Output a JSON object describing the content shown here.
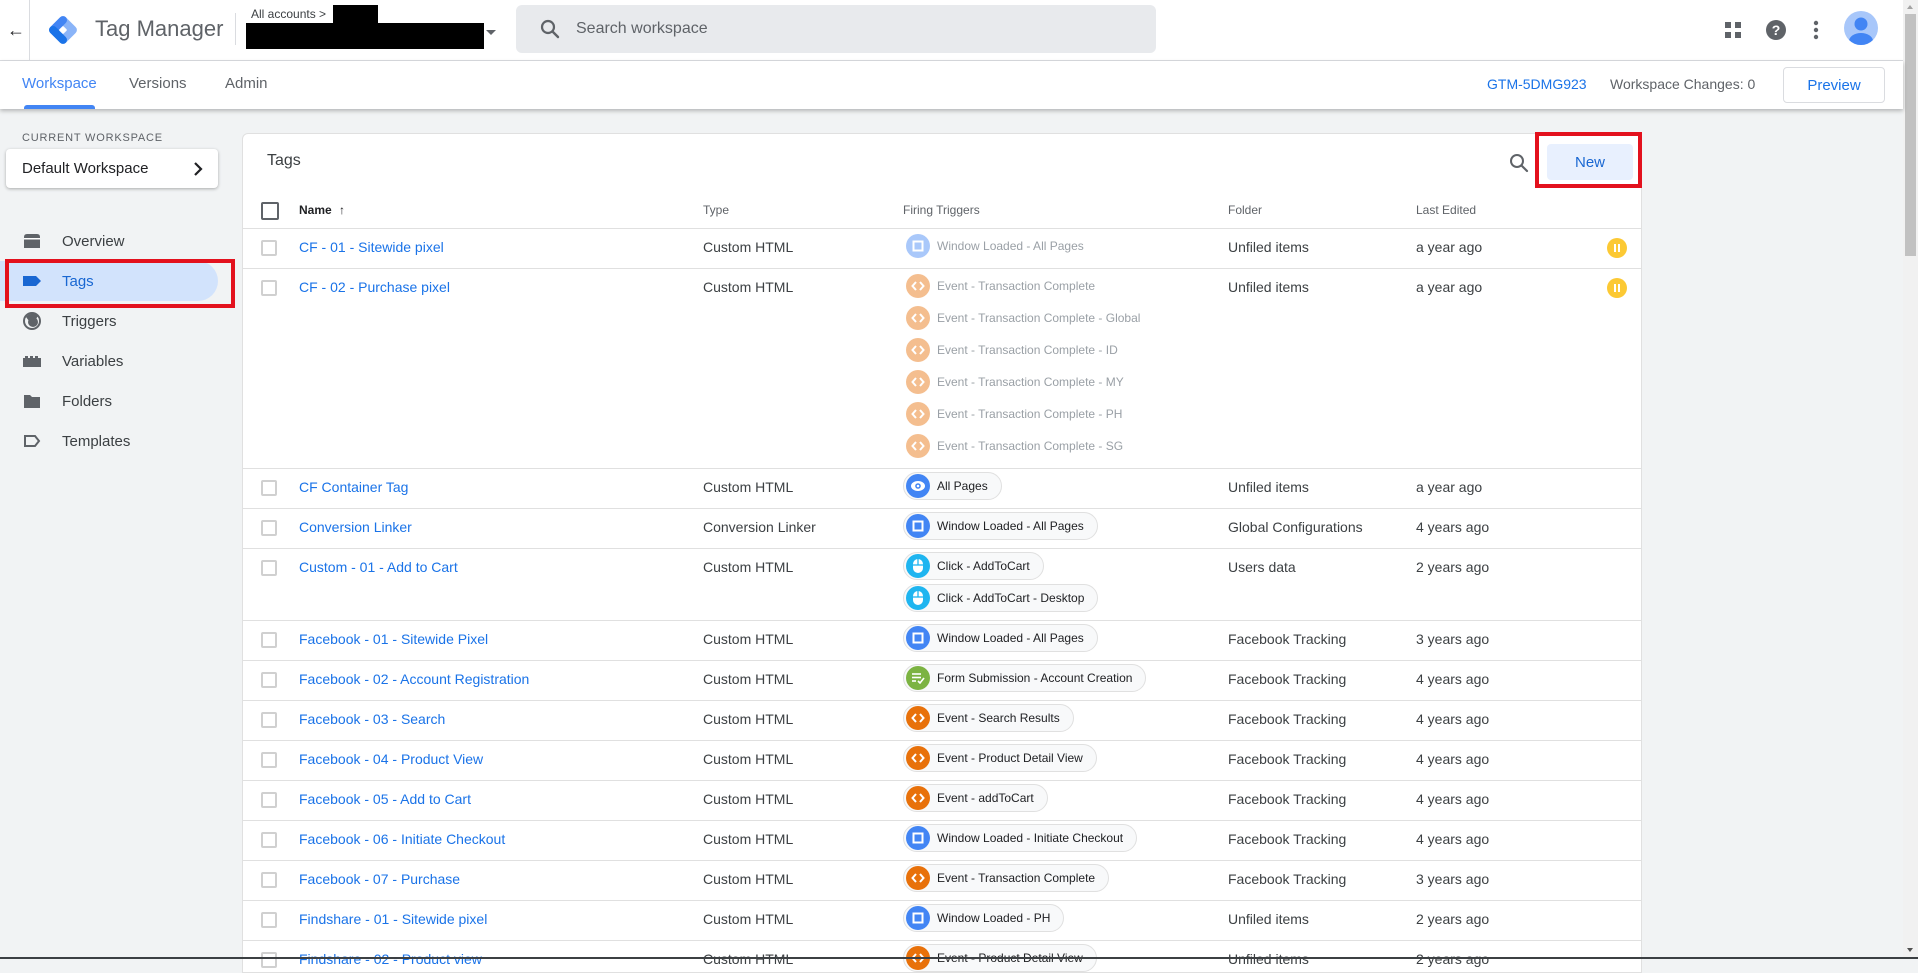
{
  "header": {
    "back_icon": "arrow-left-icon",
    "app_title": "Tag Manager",
    "account_crumb": "All accounts >",
    "search_placeholder": "Search workspace",
    "icons": [
      "apps-grid-icon",
      "help-icon",
      "more-vert-icon",
      "account-avatar-icon"
    ]
  },
  "tabs": [
    {
      "label": "Workspace",
      "active": true
    },
    {
      "label": "Versions",
      "active": false
    },
    {
      "label": "Admin",
      "active": false
    }
  ],
  "container": {
    "id": "GTM-5DMG923",
    "workspace_changes": "Workspace Changes: 0",
    "preview_label": "Preview"
  },
  "sidebar": {
    "current_workspace_label": "CURRENT WORKSPACE",
    "workspace_name": "Default Workspace",
    "items": [
      {
        "label": "Overview",
        "icon": "overview-icon",
        "active": false
      },
      {
        "label": "Tags",
        "icon": "tag-icon",
        "active": true
      },
      {
        "label": "Triggers",
        "icon": "trigger-icon",
        "active": false
      },
      {
        "label": "Variables",
        "icon": "variables-icon",
        "active": false
      },
      {
        "label": "Folders",
        "icon": "folder-icon",
        "active": false
      },
      {
        "label": "Templates",
        "icon": "template-icon",
        "active": false
      }
    ]
  },
  "tags_card": {
    "title": "Tags",
    "new_label": "New",
    "columns": {
      "name": "Name",
      "type": "Type",
      "triggers": "Firing Triggers",
      "folder": "Folder",
      "edited": "Last Edited"
    },
    "sort": "Name ascending",
    "rows": [
      {
        "name": "CF - 01 - Sitewide pixel",
        "type": "Custom HTML",
        "folder": "Unfiled items",
        "edited": "a year ago",
        "paused": true,
        "triggers": [
          {
            "label": "Window Loaded - All Pages",
            "kind": "window",
            "color": "#4285f4"
          }
        ]
      },
      {
        "name": "CF - 02 - Purchase pixel",
        "type": "Custom HTML",
        "folder": "Unfiled items",
        "edited": "a year ago",
        "paused": true,
        "triggers": [
          {
            "label": "Event - Transaction Complete",
            "kind": "event",
            "color": "#e8710a"
          },
          {
            "label": "Event - Transaction Complete - Global",
            "kind": "event",
            "color": "#e8710a"
          },
          {
            "label": "Event - Transaction Complete - ID",
            "kind": "event",
            "color": "#e8710a"
          },
          {
            "label": "Event - Transaction Complete - MY",
            "kind": "event",
            "color": "#e8710a"
          },
          {
            "label": "Event - Transaction Complete - PH",
            "kind": "event",
            "color": "#e8710a"
          },
          {
            "label": "Event - Transaction Complete - SG",
            "kind": "event",
            "color": "#e8710a"
          }
        ]
      },
      {
        "name": "CF Container Tag",
        "type": "Custom HTML",
        "folder": "Unfiled items",
        "edited": "a year ago",
        "paused": false,
        "triggers": [
          {
            "label": "All Pages",
            "kind": "pageview",
            "color": "#4285f4"
          }
        ]
      },
      {
        "name": "Conversion Linker",
        "type": "Conversion Linker",
        "folder": "Global Configurations",
        "edited": "4 years ago",
        "paused": false,
        "triggers": [
          {
            "label": "Window Loaded - All Pages",
            "kind": "window",
            "color": "#4285f4"
          }
        ]
      },
      {
        "name": "Custom - 01 - Add to Cart",
        "type": "Custom HTML",
        "folder": "Users data",
        "edited": "2 years ago",
        "paused": false,
        "triggers": [
          {
            "label": "Click - AddToCart",
            "kind": "click",
            "color": "#1fb5f0"
          },
          {
            "label": "Click - AddToCart - Desktop",
            "kind": "click",
            "color": "#1fb5f0"
          }
        ]
      },
      {
        "name": "Facebook - 01 - Sitewide Pixel",
        "type": "Custom HTML",
        "folder": "Facebook Tracking",
        "edited": "3 years ago",
        "paused": false,
        "triggers": [
          {
            "label": "Window Loaded - All Pages",
            "kind": "window",
            "color": "#4285f4"
          }
        ]
      },
      {
        "name": "Facebook - 02 - Account Registration",
        "type": "Custom HTML",
        "folder": "Facebook Tracking",
        "edited": "4 years ago",
        "paused": false,
        "triggers": [
          {
            "label": "Form Submission - Account Creation",
            "kind": "form",
            "color": "#7cb342"
          }
        ]
      },
      {
        "name": "Facebook - 03 - Search",
        "type": "Custom HTML",
        "folder": "Facebook Tracking",
        "edited": "4 years ago",
        "paused": false,
        "triggers": [
          {
            "label": "Event - Search Results",
            "kind": "event",
            "color": "#e8710a"
          }
        ]
      },
      {
        "name": "Facebook - 04 - Product View",
        "type": "Custom HTML",
        "folder": "Facebook Tracking",
        "edited": "4 years ago",
        "paused": false,
        "triggers": [
          {
            "label": "Event - Product Detail View",
            "kind": "event",
            "color": "#e8710a"
          }
        ]
      },
      {
        "name": "Facebook - 05 - Add to Cart",
        "type": "Custom HTML",
        "folder": "Facebook Tracking",
        "edited": "4 years ago",
        "paused": false,
        "triggers": [
          {
            "label": "Event - addToCart",
            "kind": "event",
            "color": "#e8710a"
          }
        ]
      },
      {
        "name": "Facebook - 06 - Initiate Checkout",
        "type": "Custom HTML",
        "folder": "Facebook Tracking",
        "edited": "4 years ago",
        "paused": false,
        "triggers": [
          {
            "label": "Window Loaded - Initiate Checkout",
            "kind": "window",
            "color": "#4285f4"
          }
        ]
      },
      {
        "name": "Facebook - 07 - Purchase",
        "type": "Custom HTML",
        "folder": "Facebook Tracking",
        "edited": "3 years ago",
        "paused": false,
        "triggers": [
          {
            "label": "Event - Transaction Complete",
            "kind": "event",
            "color": "#e8710a"
          }
        ]
      },
      {
        "name": "Findshare - 01 - Sitewide pixel",
        "type": "Custom HTML",
        "folder": "Unfiled items",
        "edited": "2 years ago",
        "paused": false,
        "triggers": [
          {
            "label": "Window Loaded - PH",
            "kind": "window",
            "color": "#4285f4"
          }
        ]
      },
      {
        "name": "Findshare - 02 - Product view",
        "type": "Custom HTML",
        "folder": "Unfiled items",
        "edited": "2 years ago",
        "paused": false,
        "triggers": [
          {
            "label": "Event - Product Detail View",
            "kind": "event",
            "color": "#e8710a"
          }
        ]
      }
    ]
  },
  "colors": {
    "accent": "#1a73e8",
    "paused_badge": "#fcc934",
    "annotation": "#e3111d",
    "active_nav_bg": "#d2e3fc"
  }
}
